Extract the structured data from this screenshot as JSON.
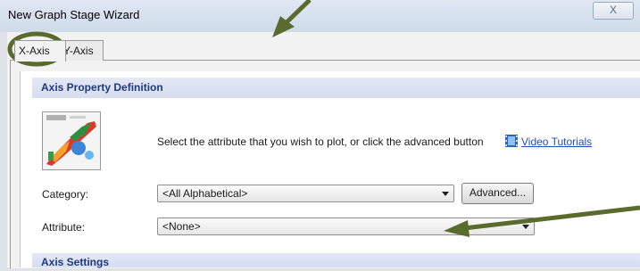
{
  "window": {
    "title": "New Graph Stage Wizard",
    "close_glyph": "X"
  },
  "tabs": [
    {
      "label": "X-Axis",
      "selected": true
    },
    {
      "label": "Y-Axis",
      "selected": false
    }
  ],
  "axis_property": {
    "header": "Axis Property Definition",
    "instruction": "Select the attribute that you wish to plot, or click the advanced button",
    "video_link": "Video Tutorials",
    "video_icon": "film-icon",
    "category_label": "Category:",
    "category_value": "<All Alphabetical>",
    "advanced_button": "Advanced...",
    "attribute_label": "Attribute:",
    "attribute_value": "<None>"
  },
  "axis_settings": {
    "header": "Axis Settings"
  },
  "colors": {
    "accent_header": "#1f3a79",
    "annotation": "#5a6b2e",
    "link": "#1f4fbf"
  }
}
